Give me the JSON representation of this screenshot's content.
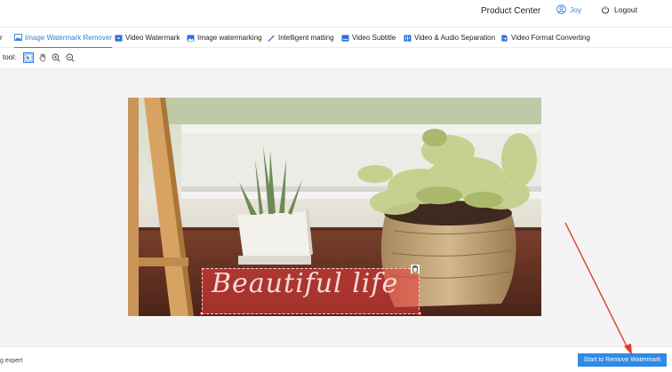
{
  "header": {
    "product_center": "Product Center",
    "username": "Joy",
    "logout": "Logout"
  },
  "tabs": [
    {
      "label": "r"
    },
    {
      "label": "Image Watermark Remover",
      "active": true
    },
    {
      "label": "Video Watermark"
    },
    {
      "label": "Image watermarking"
    },
    {
      "label": "Intelligent matting"
    },
    {
      "label": "Video Subtitle"
    },
    {
      "label": "Video & Audio Separation"
    },
    {
      "label": "Video Format Converting"
    }
  ],
  "toolbar": {
    "label": "tool:",
    "tools": [
      "select-tool",
      "hand-tool",
      "zoom-in-tool",
      "zoom-out-tool"
    ]
  },
  "canvas": {
    "watermark_text": "Beautiful life"
  },
  "footer": {
    "left_text": "g expert",
    "start_button": "Start to Remove Watermark"
  },
  "colors": {
    "accent": "#2f7fe6",
    "watermark_box": "#eb3c3c",
    "arrow": "#e23a2a"
  }
}
